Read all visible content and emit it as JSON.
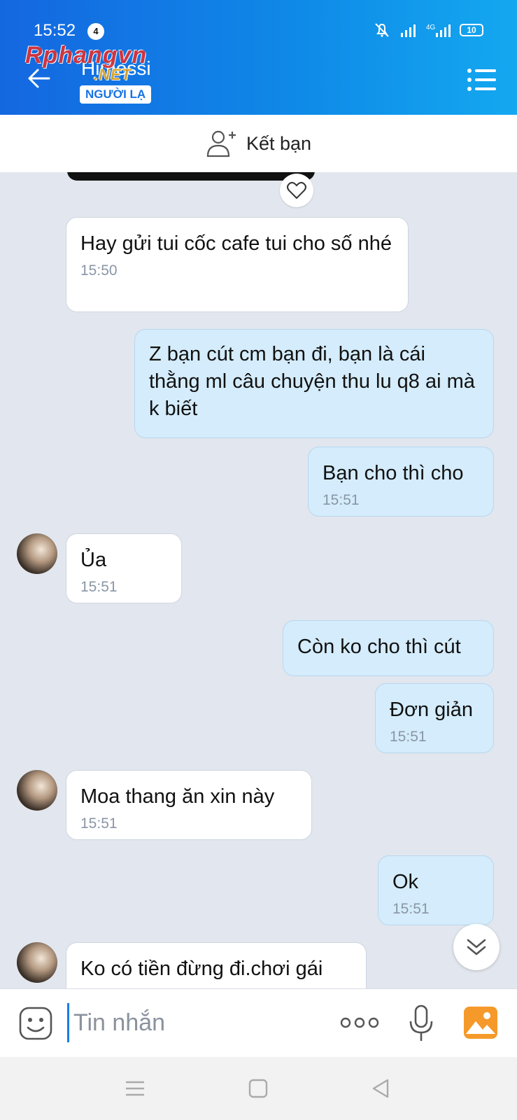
{
  "status_bar": {
    "time": "15:52",
    "notification_count": "4",
    "network": "4G",
    "battery": "10"
  },
  "header": {
    "contact_name": "Himessi",
    "stranger_label": "NGƯỜI LẠ",
    "watermark_main": "Rphangvn",
    "watermark_sub": ".NET"
  },
  "friend_bar": {
    "add_friend_label": "Kết bạn"
  },
  "messages": [
    {
      "side": "in",
      "text": "Hay gửi tui cốc cafe tui cho số nhé",
      "time": "15:50"
    },
    {
      "side": "out",
      "text": "Z bạn cút cm bạn đi, bạn là cái thằng ml câu chuyện thu lu q8 ai mà k biết",
      "time": ""
    },
    {
      "side": "out",
      "text": "Bạn cho thì cho",
      "time": "15:51"
    },
    {
      "side": "in",
      "text": "Ủa",
      "time": "15:51"
    },
    {
      "side": "out",
      "text": "Còn ko cho thì cút",
      "time": ""
    },
    {
      "side": "out",
      "text": "Đơn giản",
      "time": "15:51"
    },
    {
      "side": "in",
      "text": "Moa thang ăn xin này",
      "time": "15:51"
    },
    {
      "side": "out",
      "text": "Ok",
      "time": "15:51"
    },
    {
      "side": "in",
      "text": "Ko có tiền đừng đi.chơi gái",
      "time": ""
    }
  ],
  "input": {
    "placeholder": "Tin nhắn"
  },
  "colors": {
    "header_start": "#1467e0",
    "header_end": "#14a8f0",
    "outgoing_bubble": "#d4ecfb",
    "chat_background": "#e2e6ee"
  }
}
